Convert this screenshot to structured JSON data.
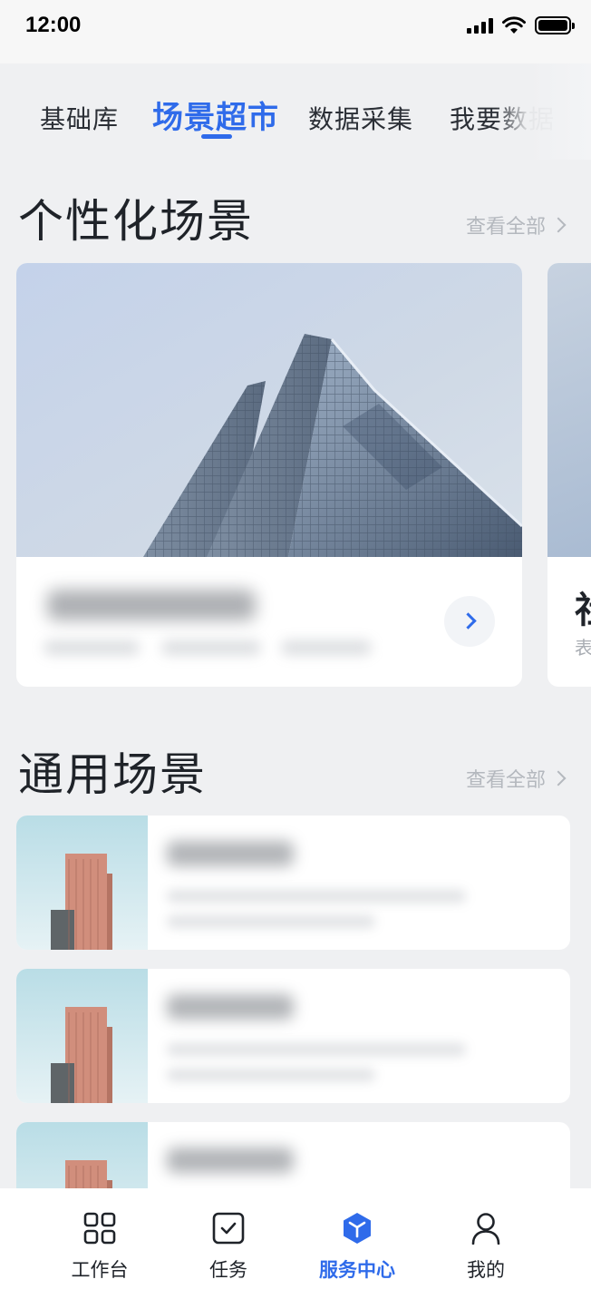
{
  "status_bar": {
    "time": "12:00"
  },
  "tabs": [
    {
      "label": "基础库"
    },
    {
      "label": "场景超市"
    },
    {
      "label": "数据采集"
    },
    {
      "label": "我要数据"
    }
  ],
  "active_tab": "场景超市",
  "sections": {
    "personalized": {
      "title": "个性化场景",
      "see_all": "查看全部"
    },
    "general": {
      "title": "通用场景",
      "see_all": "查看全部"
    }
  },
  "peek_card": {
    "title_char": "社",
    "subtitle_char": "表"
  },
  "bottom_nav": [
    {
      "label": "工作台",
      "icon": "grid-icon"
    },
    {
      "label": "任务",
      "icon": "task-check-icon"
    },
    {
      "label": "服务中心",
      "icon": "service-cube-icon"
    },
    {
      "label": "我的",
      "icon": "user-icon"
    }
  ],
  "active_nav": "服务中心",
  "colors": {
    "accent": "#2f6bea",
    "background": "#eff0f2",
    "muted_text": "#b4b8be"
  }
}
